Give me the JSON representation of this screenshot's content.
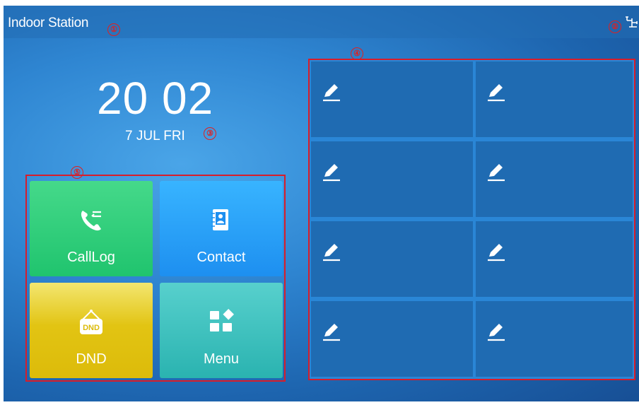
{
  "header": {
    "title": "Indoor Station"
  },
  "callouts": [
    "①",
    "②",
    "③",
    "④",
    "⑤"
  ],
  "clock": {
    "time": "20 02",
    "date": "7 JUL FRI"
  },
  "tiles": [
    {
      "label": "CallLog",
      "icon": "call-log-icon",
      "color": "#20c46e"
    },
    {
      "label": "Contact",
      "icon": "contact-book-icon",
      "color": "#1d8ff0"
    },
    {
      "label": "DND",
      "icon": "dnd-sign-icon",
      "color": "#dcbb0a"
    },
    {
      "label": "Menu",
      "icon": "menu-grid-icon",
      "color": "#2ab3b0"
    }
  ],
  "speed_dial": {
    "count": 8,
    "icon": "edit-pencil-icon"
  },
  "status": {
    "network_icon": "network-icon"
  },
  "accent_colors": {
    "frame": "#d81d2a",
    "callout": "#e02020"
  }
}
